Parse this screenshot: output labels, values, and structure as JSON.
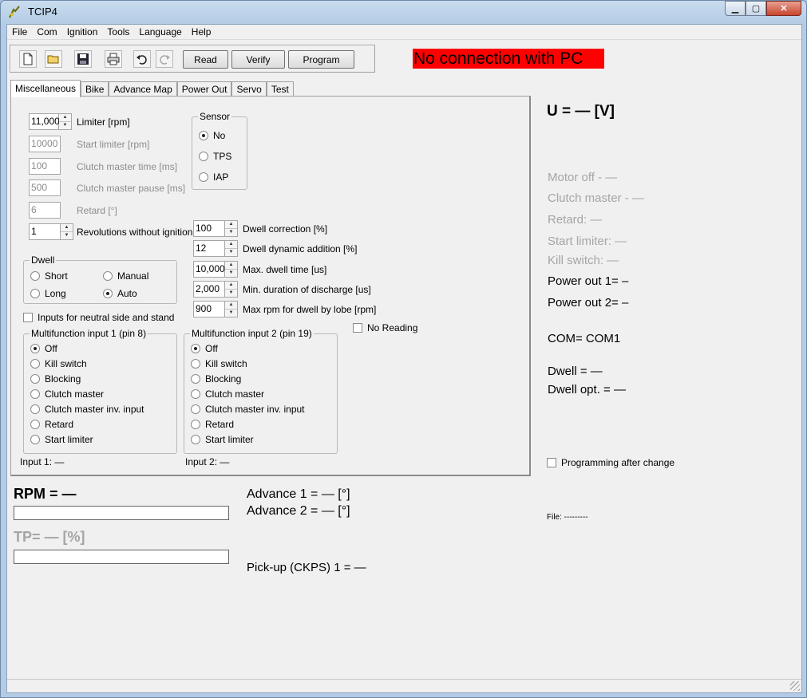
{
  "window": {
    "title": "TCIP4"
  },
  "menu": [
    "File",
    "Com",
    "Ignition",
    "Tools",
    "Language",
    "Help"
  ],
  "toolbar": {
    "read": "Read",
    "verify": "Verify",
    "program": "Program"
  },
  "connection_status": "No connection with PC",
  "tabs": [
    "Miscellaneous",
    "Bike",
    "Advance Map",
    "Power Out",
    "Servo",
    "Test"
  ],
  "misc": {
    "limiter": {
      "value": "11,000",
      "label": "Limiter [rpm]"
    },
    "start_limiter": {
      "value": "10000",
      "label": "Start limiter [rpm]"
    },
    "clutch_time": {
      "value": "100",
      "label": "Clutch master time [ms]"
    },
    "clutch_pause": {
      "value": "500",
      "label": "Clutch master pause [ms]"
    },
    "retard": {
      "value": "6",
      "label": "Retard [°]"
    },
    "revs": {
      "value": "1",
      "label": "Revolutions without ignition"
    },
    "sensor": {
      "title": "Sensor",
      "options": [
        "No",
        "TPS",
        "IAP"
      ],
      "selected": "No"
    },
    "dwell_correction": {
      "value": "100",
      "label": "Dwell correction [%]"
    },
    "dwell_dynamic": {
      "value": "12",
      "label": "Dwell dynamic addition [%]"
    },
    "max_dwell": {
      "value": "10,000",
      "label": "Max. dwell time [us]"
    },
    "min_discharge": {
      "value": "2,000",
      "label": "Min. duration of discharge [us]"
    },
    "max_rpm_dwell": {
      "value": "900",
      "label": "Max rpm for dwell by lobe [rpm]"
    },
    "dwell": {
      "title": "Dwell",
      "short": "Short",
      "manual": "Manual",
      "long": "Long",
      "auto": "Auto",
      "selected": "Auto"
    },
    "neutral_inputs": "Inputs for neutral side and stand",
    "no_reading": "No Reading",
    "mf1": {
      "title": "Multifunction input 1 (pin 8)",
      "options": [
        "Off",
        "Kill switch",
        "Blocking",
        "Clutch master",
        "Clutch master inv. input",
        "Retard",
        "Start limiter"
      ],
      "selected": "Off"
    },
    "mf2": {
      "title": "Multifunction input 2 (pin 19)",
      "options": [
        "Off",
        "Kill switch",
        "Blocking",
        "Clutch master",
        "Clutch master inv. input",
        "Retard",
        "Start limiter"
      ],
      "selected": "Off"
    },
    "input1": "Input 1: —",
    "input2": "Input 2: —"
  },
  "right": {
    "voltage": "U = — [V]",
    "motor_off": "Motor off - —",
    "clutch_master": "Clutch master - —",
    "retard": "Retard: —",
    "start_limiter": "Start limiter: —",
    "kill_switch": "Kill switch: —",
    "power_out1": "Power out 1= –",
    "power_out2": "Power out 2= –",
    "com": "COM= COM1",
    "dwell": "Dwell = —",
    "dwell_opt": "Dwell opt. = —",
    "programming_after_change": "Programming after change",
    "file": "File:   ---------"
  },
  "readouts": {
    "rpm": "RPM = —",
    "tp": "TP= — [%]",
    "advance1": "Advance 1 = — [°]",
    "advance2": "Advance 2 = — [°]",
    "pickup": "Pick-up (CKPS) 1 = —"
  }
}
